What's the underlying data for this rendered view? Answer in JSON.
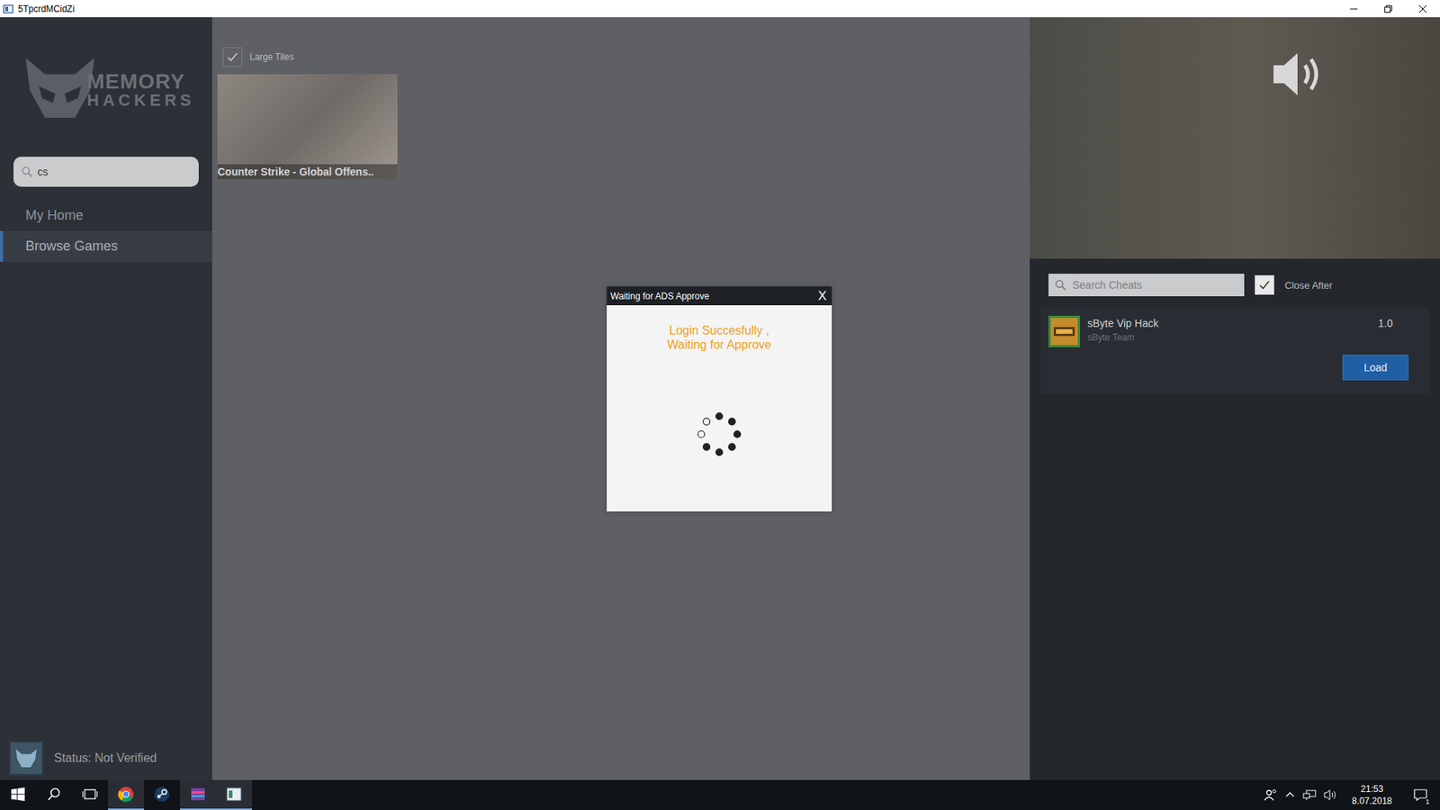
{
  "window": {
    "title": "5TpcrdMCidZi"
  },
  "logo": {
    "line1": "MEMORY",
    "line2": "HACKERS"
  },
  "sidebar": {
    "search": {
      "value": "cs"
    },
    "items": [
      {
        "label": "My Home",
        "selected": false
      },
      {
        "label": "Browse Games",
        "selected": true
      }
    ],
    "status": "Status: Not Verified"
  },
  "games": {
    "large_tiles": {
      "label": "Large Tiles",
      "checked": true
    },
    "tiles": [
      {
        "title": "Counter Strike - Global Offens.."
      }
    ]
  },
  "cheats": {
    "search": {
      "placeholder": "Search Cheats"
    },
    "close_after": {
      "label": "Close After",
      "checked": true
    },
    "items": [
      {
        "name": "sByte Vip Hack",
        "author": "sByte Team",
        "version": "1.0"
      }
    ],
    "button": "Load"
  },
  "dialog": {
    "title": "Waiting for ADS Approve",
    "close": "X",
    "message": [
      "Login Succesfully ,",
      "Waiting for Approve"
    ]
  },
  "taskbar": {
    "time": "21:53",
    "date": "8.07.2018",
    "notifications": "1"
  }
}
